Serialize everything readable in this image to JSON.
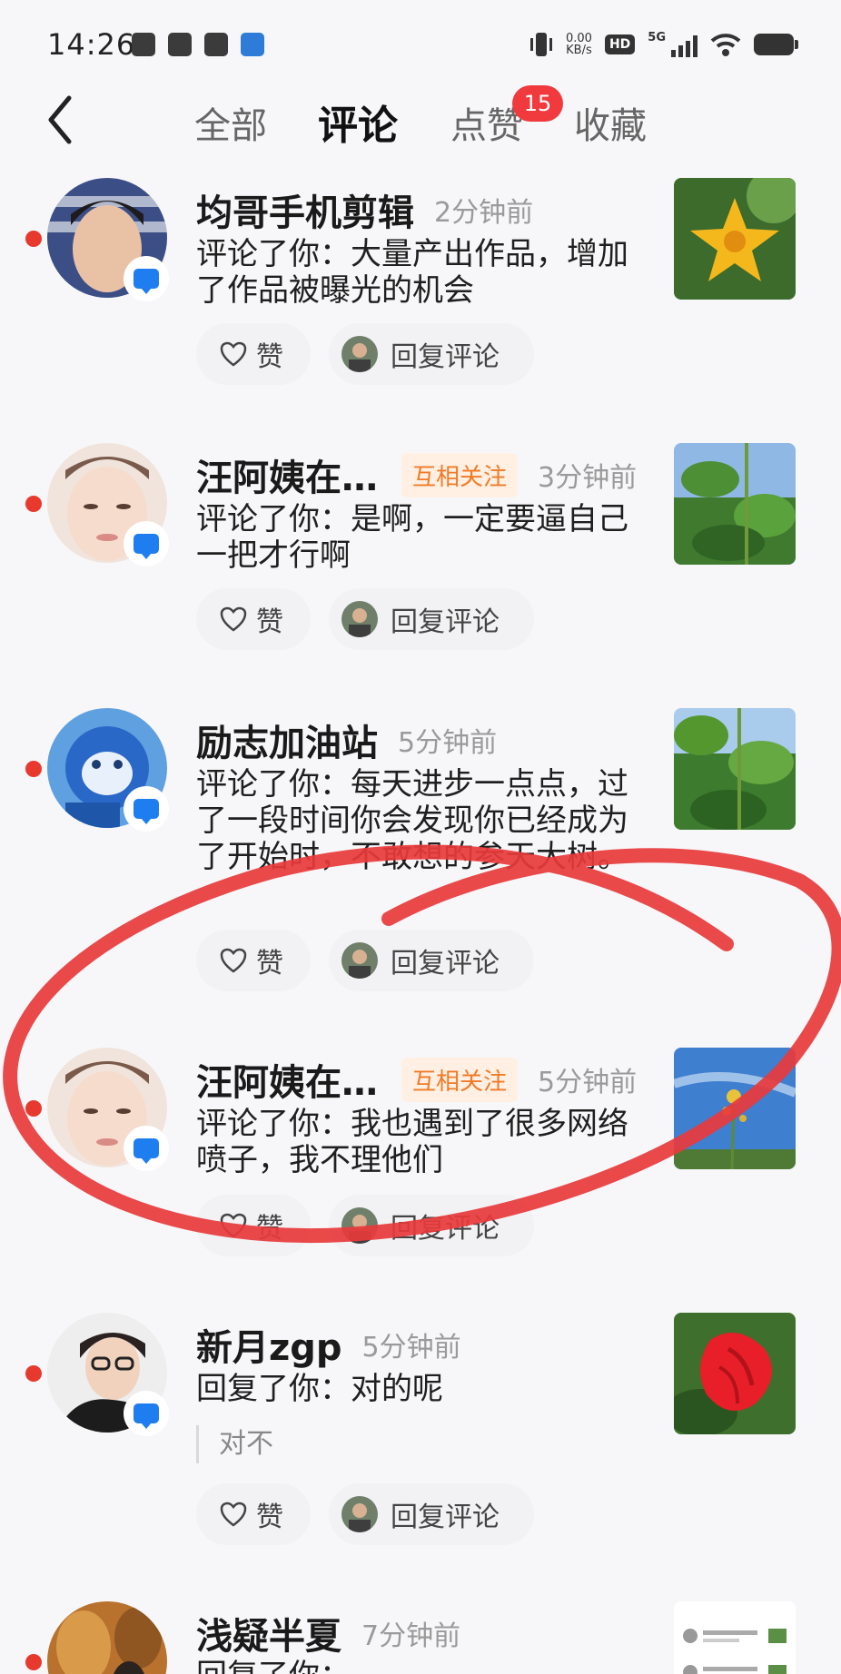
{
  "status_bar": {
    "time": "14:26",
    "speed_value": "0.00",
    "speed_unit": "KB/s",
    "hd": "HD",
    "network": "5G"
  },
  "nav": {
    "back_icon": "chevron-left-icon",
    "tabs": [
      "全部",
      "评论",
      "点赞",
      "收藏"
    ],
    "active_tab": "评论",
    "like_badge": "15"
  },
  "actions": {
    "like_label": "赞",
    "reply_label": "回复评论"
  },
  "items": [
    {
      "name": "均哥手机剪辑",
      "mutual": "",
      "time": "2分钟前",
      "comment": "评论了你：大量产出作品，增加了作品被曝光的机会",
      "quote": "",
      "thumb": "yellow-flower"
    },
    {
      "name": "汪阿姨在…",
      "mutual": "互相关注",
      "time": "3分钟前",
      "comment": "评论了你：是啊，一定要逼自己一把才行啊",
      "quote": "",
      "thumb": "green-plant"
    },
    {
      "name": "励志加油站",
      "mutual": "",
      "time": "5分钟前",
      "comment": "评论了你：每天进步一点点，过了一段时间你会发现你已经成为了开始时，不敢想的参天大树。",
      "quote": "",
      "thumb": "green-plant"
    },
    {
      "name": "汪阿姨在…",
      "mutual": "互相关注",
      "time": "5分钟前",
      "comment": "评论了你：我也遇到了很多网络喷子，我不理他们",
      "quote": "",
      "thumb": "sky-flower"
    },
    {
      "name": "新月zgp",
      "mutual": "",
      "time": "5分钟前",
      "comment": "回复了你：对的呢",
      "quote": "对不",
      "thumb": "red-flower"
    },
    {
      "name": "浅疑半夏",
      "mutual": "",
      "time": "7分钟前",
      "comment": "回复了你：",
      "quote": "",
      "thumb": "screenshot"
    }
  ],
  "colors": {
    "unread_dot": "#e8392f",
    "badge": "#f03a3e",
    "mutual_text": "#f07a26",
    "mutual_bg": "#fff0e3",
    "chat_badge": "#1e7ef0",
    "scribble": "#e8393b"
  }
}
